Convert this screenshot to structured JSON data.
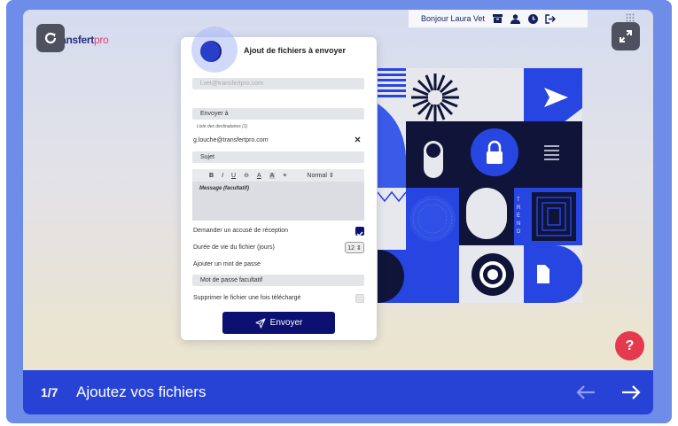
{
  "header": {
    "greeting": "Bonjour Laura Vet",
    "icons": [
      "archive-icon",
      "user-icon",
      "clock-icon",
      "logout-icon"
    ]
  },
  "logo": {
    "brand": "transfert",
    "suffix": "pro"
  },
  "form": {
    "title": "Ajout de fichiers à envoyer",
    "sender_placeholder": "l.vet@transfertpro.com",
    "send_to_label": "Envoyer à",
    "recipients_caption": "Liste des destinataires (1)",
    "recipient": "g.louche@transfertpro.com",
    "subject_label": "Sujet",
    "toolbar": {
      "bold": "B",
      "italic": "I",
      "underline": "U",
      "strike": "⊖",
      "color": "A",
      "highlight": "A",
      "align": "≡",
      "style": "Normal ⇕"
    },
    "message_placeholder": "Message (facultatif)",
    "receipt_label": "Demander un accusé de réception",
    "receipt_checked": true,
    "lifetime_label": "Durée de vie du fichier (jours)",
    "lifetime_value": "12 ⇕",
    "password_label": "Ajouter un mot de passe",
    "password_placeholder": "Mot de passe facultatif",
    "delete_label": "Supprimer le fichier une fois téléchargé",
    "delete_checked": false,
    "send_button": "Envoyer"
  },
  "art": {
    "vertical_text": "TREND"
  },
  "help": {
    "label": "?"
  },
  "footer": {
    "step": "1/7",
    "title": "Ajoutez vos fichiers"
  },
  "colors": {
    "navy": "#0c1070",
    "blue": "#2743d6",
    "accent_red": "#e53a4e"
  }
}
